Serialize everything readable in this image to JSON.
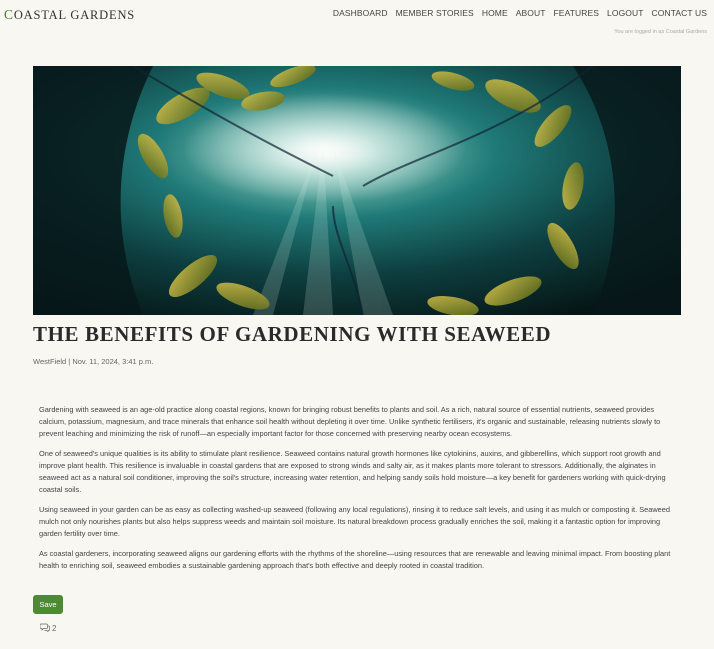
{
  "brand": {
    "first_letter": "C",
    "rest": "OASTAL",
    "second_word": "GARDENS"
  },
  "nav": {
    "items": [
      "DASHBOARD",
      "MEMBER STORIES",
      "HOME",
      "ABOUT",
      "FEATURES",
      "LOGOUT",
      "CONTACT US"
    ]
  },
  "login_note": "You are logged in as Coastal Gardens",
  "article": {
    "title": "The Benefits of Gardening with Seaweed",
    "meta": "WestField | Nov. 11, 2024, 3:41 p.m.",
    "paragraphs": [
      "Gardening with seaweed is an age-old practice along coastal regions, known for bringing robust benefits to plants and soil. As a rich, natural source of essential nutrients, seaweed provides calcium, potassium, magnesium, and trace minerals that enhance soil health without depleting it over time. Unlike synthetic fertilisers, it's organic and sustainable, releasing nutrients slowly to prevent leaching and minimizing the risk of runoff—an especially important factor for those concerned with preserving nearby ocean ecosystems.",
      "One of seaweed's unique qualities is its ability to stimulate plant resilience. Seaweed contains natural growth hormones like cytokinins, auxins, and gibberellins, which support root growth and improve plant health. This resilience is invaluable in coastal gardens that are exposed to strong winds and salty air, as it makes plants more tolerant to stressors. Additionally, the alginates in seaweed act as a natural soil conditioner, improving the soil's structure, increasing water retention, and helping sandy soils hold moisture—a key benefit for gardeners working with quick-drying coastal soils.",
      "Using seaweed in your garden can be as easy as collecting washed-up seaweed (following any local regulations), rinsing it to reduce salt levels, and using it as mulch or composting it. Seaweed mulch not only nourishes plants but also helps suppress weeds and maintain soil moisture. Its natural breakdown process gradually enriches the soil, making it a fantastic option for improving garden fertility over time.",
      "As coastal gardeners, incorporating seaweed aligns our gardening efforts with the rhythms of the shoreline—using resources that are renewable and leaving minimal impact. From boosting plant health to enriching soil, seaweed embodies a sustainable gardening approach that's both effective and deeply rooted in coastal tradition."
    ]
  },
  "actions": {
    "save_label": "Save",
    "comment_count": "2"
  },
  "colors": {
    "accent": "#4e8a34",
    "background": "#f8f7f2"
  }
}
